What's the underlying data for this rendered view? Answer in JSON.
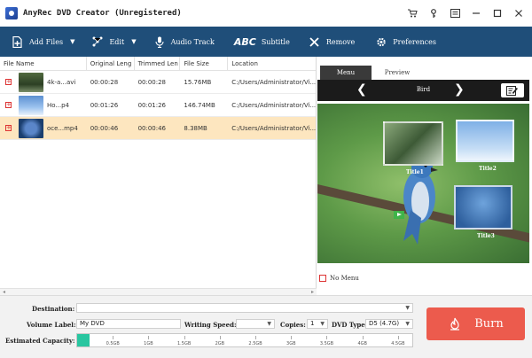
{
  "window": {
    "title": "AnyRec DVD Creator (Unregistered)"
  },
  "toolbar": {
    "add_files": "Add Files",
    "edit": "Edit",
    "audio_track": "Audio Track",
    "subtitle_abc": "ABC",
    "subtitle": "Subtitle",
    "remove": "Remove",
    "preferences": "Preferences"
  },
  "file_list": {
    "columns": [
      "File Name",
      "Original Leng",
      "Trimmed Len",
      "File Size",
      "Location"
    ],
    "rows": [
      {
        "name": "4k-a...avi",
        "original": "00:00:28",
        "trimmed": "00:00:28",
        "size": "15.76MB",
        "location": "C:/Users/Administrator/Vi..."
      },
      {
        "name": "Ho...p4",
        "original": "00:01:26",
        "trimmed": "00:01:26",
        "size": "146.74MB",
        "location": "C:/Users/Administrator/Vi..."
      },
      {
        "name": "oce...mp4",
        "original": "00:00:46",
        "trimmed": "00:00:46",
        "size": "8.38MB",
        "location": "C:/Users/Administrator/Vi..."
      }
    ]
  },
  "menu_panel": {
    "tabs": [
      "Menu",
      "Preview"
    ],
    "active_tab": "Menu",
    "theme_name": "Bird",
    "thumbs": [
      "Title1",
      "Title2",
      "Title3"
    ],
    "no_menu": "No Menu"
  },
  "bottom": {
    "destination_label": "Destination:",
    "destination_value": "",
    "volume_label": "Volume Label:",
    "volume_value": "My DVD",
    "writing_speed_label": "Writing Speed:",
    "writing_speed_value": "",
    "copies_label": "Copies:",
    "copies_value": "1",
    "dvd_type_label": "DVD Type:",
    "dvd_type_value": "D5 (4.7G)",
    "capacity_label": "Estimated Capacity:",
    "capacity_ticks": [
      "0.5GB",
      "1GB",
      "1.5GB",
      "2GB",
      "2.5GB",
      "3GB",
      "3.5GB",
      "4GB",
      "4.5GB"
    ],
    "capacity_used_gb": 0.17,
    "capacity_max_gb": 4.7,
    "burn_label": "Burn"
  },
  "colors": {
    "toolbar_bg": "#1f4e79",
    "selected_row": "#fde6bf",
    "burn_button": "#ec5b4d",
    "capacity_fill": "#28c6a0"
  }
}
